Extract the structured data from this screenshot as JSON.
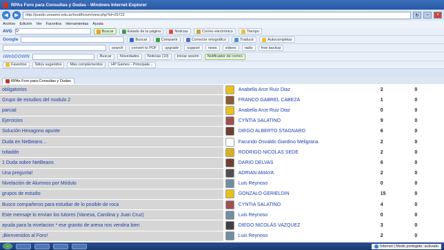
{
  "window": {
    "title": "RPAs Foro para Consultas y Dudas - Windows Internet Explorer",
    "address": "http://puedo.unsame.edu.ar/mod/forum/view.php?id=25722"
  },
  "menu": [
    "Archivo",
    "Edición",
    "Ver",
    "Favoritos",
    "Herramientas",
    "Ayuda"
  ],
  "toolbar1": {
    "brand": "AVG",
    "search_placeholder": "Q-",
    "buscar": "Buscar",
    "estado": "Estado de la página",
    "noticias": "Noticias",
    "correo": "Correo electrónico",
    "tiempo": "Tiempo"
  },
  "toolbar2": {
    "brand": "Google",
    "buscar": "Buscar",
    "compartir": "Compartir",
    "corrector": "Corrector ortográfico",
    "traducir": "Traducir",
    "autocompletar": "Autocompletar"
  },
  "toolbar3": {
    "search": "search",
    "convert": "convert to PDF",
    "upgrade": "upgrade",
    "support": "support",
    "news": "news",
    "videos": "videos",
    "radio": "radio",
    "backup": "free backup"
  },
  "toolbar4": {
    "brand": "iWebDOWN",
    "buscar": "Buscar",
    "novedades": "Novedades",
    "noticias": "Noticias (10)",
    "iniciar": "Iniciar sesión",
    "notificador": "Notificador de correo"
  },
  "favorites": {
    "label": "Favoritos",
    "sitios": "Sitios sugeridos",
    "galeria": "Más complementos",
    "hp": "HP Games - Principale..."
  },
  "tab": {
    "label": "RPAs Foro para Consultas y Dudas"
  },
  "topics": [
    {
      "title": "obligatorios",
      "author": "Anabella Arce Ruiz Diaz",
      "replies": "2",
      "unread": "0",
      "avatar": "#e8c020"
    },
    {
      "title": "Grupo de estudios del modulo 2",
      "author": "FRANCO GABREL CABEZA",
      "replies": "1",
      "unread": "0",
      "avatar": "#8a5a3a"
    },
    {
      "title": "parcial",
      "author": "Anabella Arce Ruiz Diaz",
      "replies": "0",
      "unread": "0",
      "avatar": "#e8c020"
    },
    {
      "title": "Ejercicios",
      "author": "CYNTIA SALATINO",
      "replies": "9",
      "unread": "0",
      "avatar": "#a05050"
    },
    {
      "title": "Solución Hexagono apunte",
      "author": "DIEGO ALBERTO STAGNARO",
      "replies": "6",
      "unread": "0",
      "avatar": "#6a4030"
    },
    {
      "title": "Duda en Netbeans...",
      "author": "Facundo Osvaldo Giardino Meligrana",
      "replies": "2",
      "unread": "0",
      "avatar": "#ffffff"
    },
    {
      "title": "txtladdn",
      "author": "RODRIGO NICOLAS SEDE",
      "replies": "2",
      "unread": "0",
      "avatar": "#d8b020"
    },
    {
      "title": "1 Duda sobre NetBeans",
      "author": "DARIO DELVAS",
      "replies": "6",
      "unread": "0",
      "avatar": "#704030"
    },
    {
      "title": "Una pregunta!",
      "author": "ADRIAN AMAYA",
      "replies": "2",
      "unread": "0",
      "avatar": "#505050"
    },
    {
      "title": "Nivelación de Alumnos por Módulo",
      "author": "Luis Reynoso",
      "replies": "0",
      "unread": "0",
      "avatar": "#6f8fa0"
    },
    {
      "title": "grupos de estudio",
      "author": "GONZALO GERIELDIN",
      "replies": "15",
      "unread": "0",
      "avatar": "#e8c020"
    },
    {
      "title": "Busco compañeros para estudiar de lo posible de roca",
      "author": "CYNTIA SALATINO",
      "replies": "4",
      "unread": "0",
      "avatar": "#a05050"
    },
    {
      "title": "Este mensaje lo envian los tutores (Vanesa, Carolina y Juan Cruz)",
      "author": "Luis Reynoso",
      "replies": "0",
      "unread": "0",
      "avatar": "#6f8fa0"
    },
    {
      "title": "ayuda para la nivelacion * ese granito de arena nos vendria bien",
      "author": "DIEGO NICOLÁS VAZQUEZ",
      "replies": "3",
      "unread": "0",
      "avatar": "#404040"
    },
    {
      "title": "¡Bienvenidos al Foro!",
      "author": "Luis Reynoso",
      "replies": "2",
      "unread": "0",
      "avatar": "#6f8fa0"
    }
  ],
  "status": {
    "zone": "Internet | Modo protegido: activado"
  }
}
